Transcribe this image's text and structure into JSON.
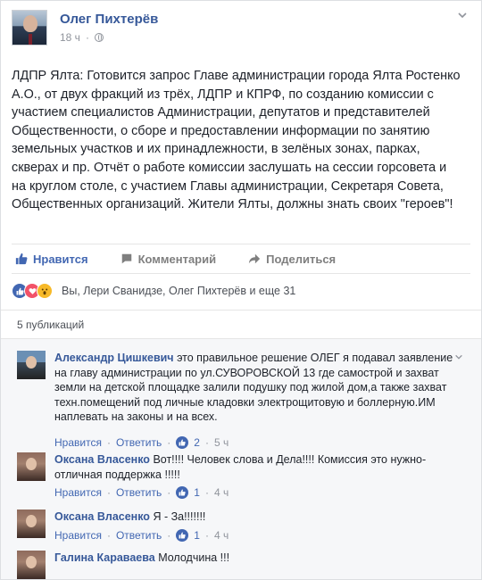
{
  "post": {
    "author": "Олег Пихтерёв",
    "time": "18 ч",
    "text": "ЛДПР Ялта: Готовится запрос Главе администрации города Ялта Ростенко А.О., от двух фракций из трёх, ЛДПР и КПРФ, по созданию комиссии с участием специалистов Администрации, депутатов и представителей Общественности, о сборе и предоставлении информации по занятию земельных участков и их принадлежности, в зелёных зонах, парках, скверах и пр. Отчёт о работе комиссии заслушать на сессии горсовета и на круглом столе, с участием Главы администрации, Секретаря Совета, Общественных организаций. Жители Ялты, должны знать своих \"героев\"!"
  },
  "actions": {
    "like": "Нравится",
    "comment": "Комментарий",
    "share": "Поделиться"
  },
  "reactions": {
    "summary": "Вы, Лери Сванидзе, Олег Пихтерёв и еще 31"
  },
  "publications": "5 публикаций",
  "comments": [
    {
      "name": "Александр Цишкевич",
      "text": "это правильное решение ОЛЕГ я подавал заявление на главу администрации по ул.СУВОРОВСКОЙ 13 где самострой и захват земли на детской площадке залили подушку под жилой дом,а также захват техн.помещений под личные кладовки электрощитовую и боллерную.ИМ наплевать на законы и на всех.",
      "like": "Нравится",
      "reply": "Ответить",
      "likes": "2",
      "time": "5 ч"
    },
    {
      "name": "Оксана Власенко",
      "text": "Вот!!!! Человек слова и Дела!!!! Комиссия это нужно- отличная поддержка !!!!!",
      "like": "Нравится",
      "reply": "Ответить",
      "likes": "1",
      "time": "4 ч"
    },
    {
      "name": "Оксана Власенко",
      "text": "Я - За!!!!!!!",
      "like": "Нравится",
      "reply": "Ответить",
      "likes": "1",
      "time": "4 ч"
    },
    {
      "name": "Галина Караваева",
      "text": "Молодчина !!!",
      "like": "",
      "reply": "",
      "likes": "",
      "time": ""
    }
  ]
}
